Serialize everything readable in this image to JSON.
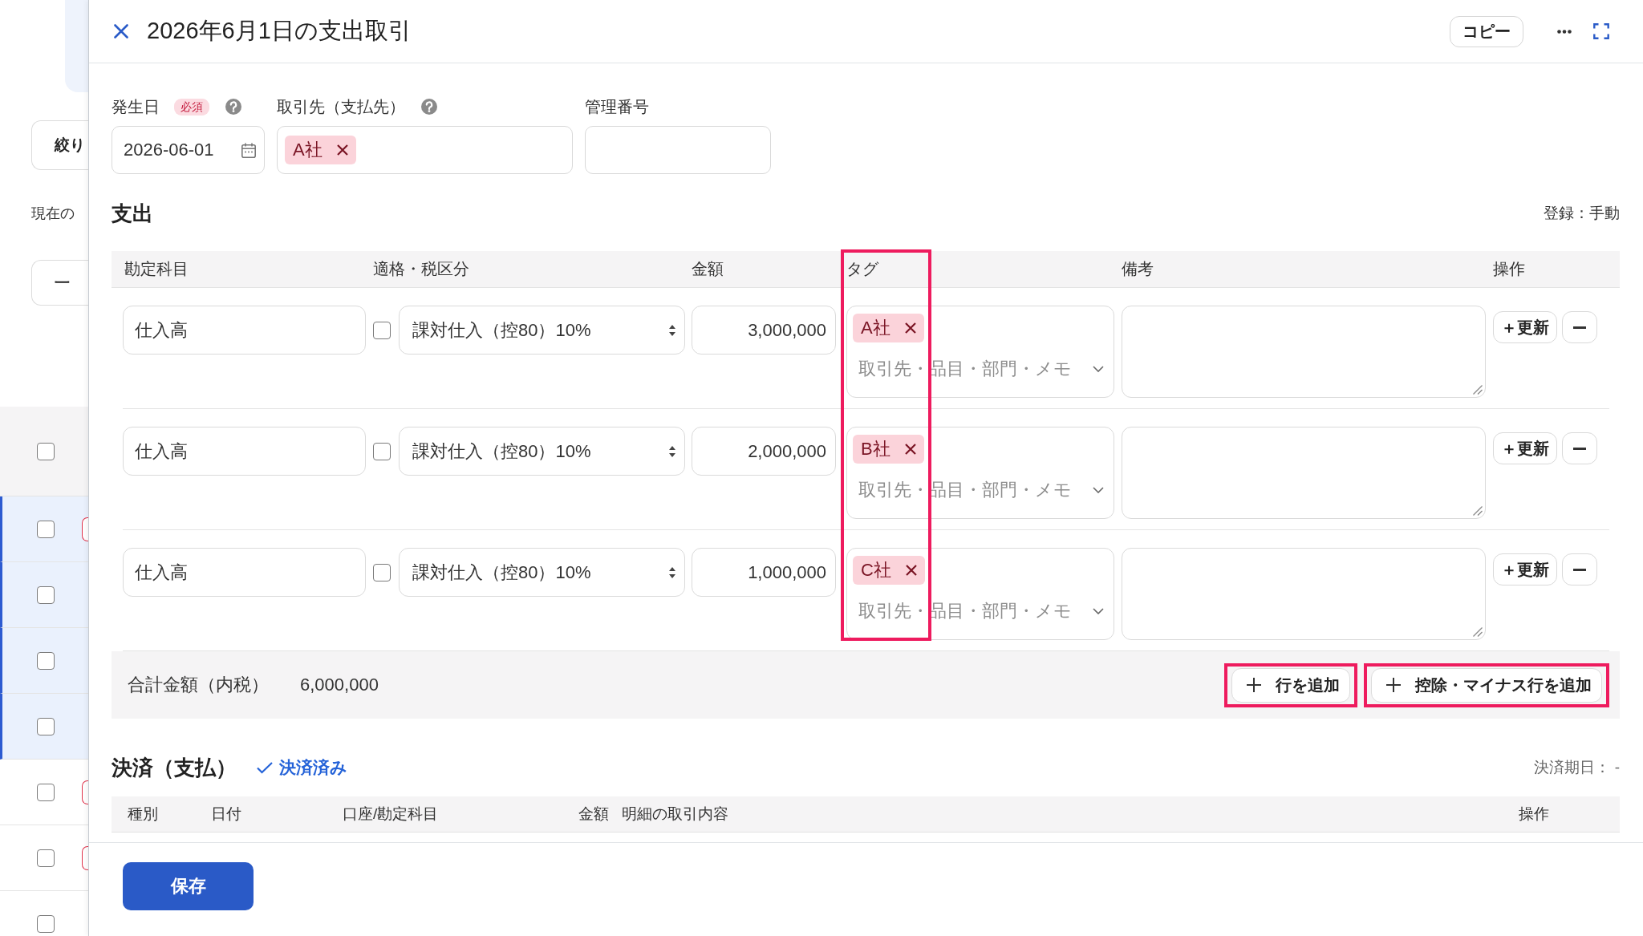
{
  "background": {
    "filter_button": "絞り",
    "status_text": "現在の",
    "bulk_button": "一",
    "rows": [
      {
        "kind": "header",
        "selected": false,
        "checked": false,
        "badge": false
      },
      {
        "kind": "item",
        "selected": true,
        "checked": false,
        "badge": true
      },
      {
        "kind": "item",
        "selected": true,
        "checked": false,
        "badge": false
      },
      {
        "kind": "item",
        "selected": true,
        "checked": false,
        "badge": false
      },
      {
        "kind": "item",
        "selected": true,
        "checked": false,
        "badge": false
      },
      {
        "kind": "item",
        "selected": false,
        "checked": false,
        "badge": true
      },
      {
        "kind": "item",
        "selected": false,
        "checked": false,
        "badge": true
      },
      {
        "kind": "item",
        "selected": false,
        "checked": false,
        "badge": false
      }
    ]
  },
  "panel": {
    "title": "2026年6月1日の支出取引",
    "copy_button": "コピー"
  },
  "form": {
    "fields": [
      {
        "kind": "date",
        "label": "発生日",
        "required_badge": "必須",
        "help": true,
        "value": "2026-06-01"
      },
      {
        "kind": "tags",
        "label": "取引先（支払先）",
        "help": true,
        "tags": [
          "A社"
        ]
      },
      {
        "kind": "text",
        "label": "管理番号",
        "help": false
      }
    ]
  },
  "expense": {
    "heading": "支出",
    "registration": "登録：手動",
    "columns": [
      "勘定科目",
      "適格・税区分",
      "金額",
      "タグ",
      "備考",
      "操作"
    ],
    "tag_column_highlighted": true,
    "rows": [
      {
        "account": "仕入高",
        "qualified": false,
        "tax_category": "課対仕入（控80）10%",
        "amount": "3,000,000",
        "tag_field": {
          "tags": [
            "A社"
          ],
          "placeholder": "取引先・品目・部門・メモ"
        },
        "update_button": "＋更新"
      },
      {
        "account": "仕入高",
        "qualified": false,
        "tax_category": "課対仕入（控80）10%",
        "amount": "2,000,000",
        "tag_field": {
          "tags": [
            "B社"
          ],
          "placeholder": "取引先・品目・部門・メモ"
        },
        "update_button": "＋更新"
      },
      {
        "account": "仕入高",
        "qualified": false,
        "tax_category": "課対仕入（控80）10%",
        "amount": "1,000,000",
        "tag_field": {
          "tags": [
            "C社"
          ],
          "placeholder": "取引先・品目・部門・メモ"
        },
        "update_button": "＋更新"
      }
    ],
    "total": {
      "label": "合計金額（内税）",
      "value": "6,000,000"
    },
    "add_buttons": [
      {
        "label": "行を追加",
        "highlighted": true
      },
      {
        "label": "控除・マイナス行を追加",
        "highlighted": true
      }
    ]
  },
  "payment": {
    "heading": "決済（支払）",
    "status": "決済済み",
    "due_date": "決済期日： -",
    "columns": [
      "種別",
      "日付",
      "口座/勘定科目",
      "金額",
      "明細の取引内容",
      "操作"
    ]
  },
  "save_button": "保存"
}
